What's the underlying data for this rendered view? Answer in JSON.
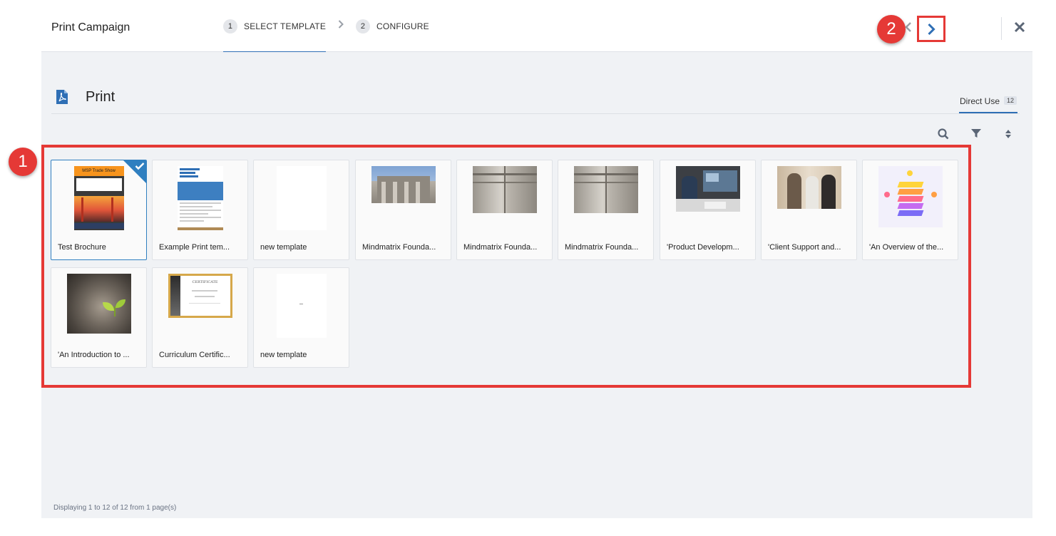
{
  "header": {
    "title": "Print Campaign",
    "steps": [
      {
        "num": "1",
        "label": "SELECT TEMPLATE"
      },
      {
        "num": "2",
        "label": "CONFIGURE"
      }
    ]
  },
  "badges": {
    "one": "1",
    "two": "2"
  },
  "section": {
    "title": "Print",
    "view_tab": "Direct Use",
    "view_count": "12"
  },
  "templates": [
    {
      "name": "Test Brochure",
      "selected": true,
      "thumb": "brochure"
    },
    {
      "name": "Example Print tem...",
      "selected": false,
      "thumb": "datasheet"
    },
    {
      "name": "new template",
      "selected": false,
      "thumb": "blank"
    },
    {
      "name": "Mindmatrix Founda...",
      "selected": false,
      "thumb": "building-columns"
    },
    {
      "name": "Mindmatrix Founda...",
      "selected": false,
      "thumb": "building-corner"
    },
    {
      "name": "Mindmatrix Founda...",
      "selected": false,
      "thumb": "building-corner"
    },
    {
      "name": "'Product Developm...",
      "selected": false,
      "thumb": "office-screens"
    },
    {
      "name": "'Client Support and...",
      "selected": false,
      "thumb": "handshake"
    },
    {
      "name": "'An Overview of the...",
      "selected": false,
      "thumb": "layers-infographic"
    },
    {
      "name": "'An Introduction to ...",
      "selected": false,
      "thumb": "sprout-stump"
    },
    {
      "name": "Curriculum Certific...",
      "selected": false,
      "thumb": "certificate"
    },
    {
      "name": "new template",
      "selected": false,
      "thumb": "blank-dot"
    }
  ],
  "thumb_text": {
    "brochure_banner": "MSP Trade Show",
    "certificate_title": "CERTIFICATE"
  },
  "footer": "Displaying 1 to 12 of 12 from 1 page(s)",
  "colors": {
    "accent": "#2f6fb5",
    "highlight": "#e53936",
    "page_bg": "#f0f2f5"
  }
}
